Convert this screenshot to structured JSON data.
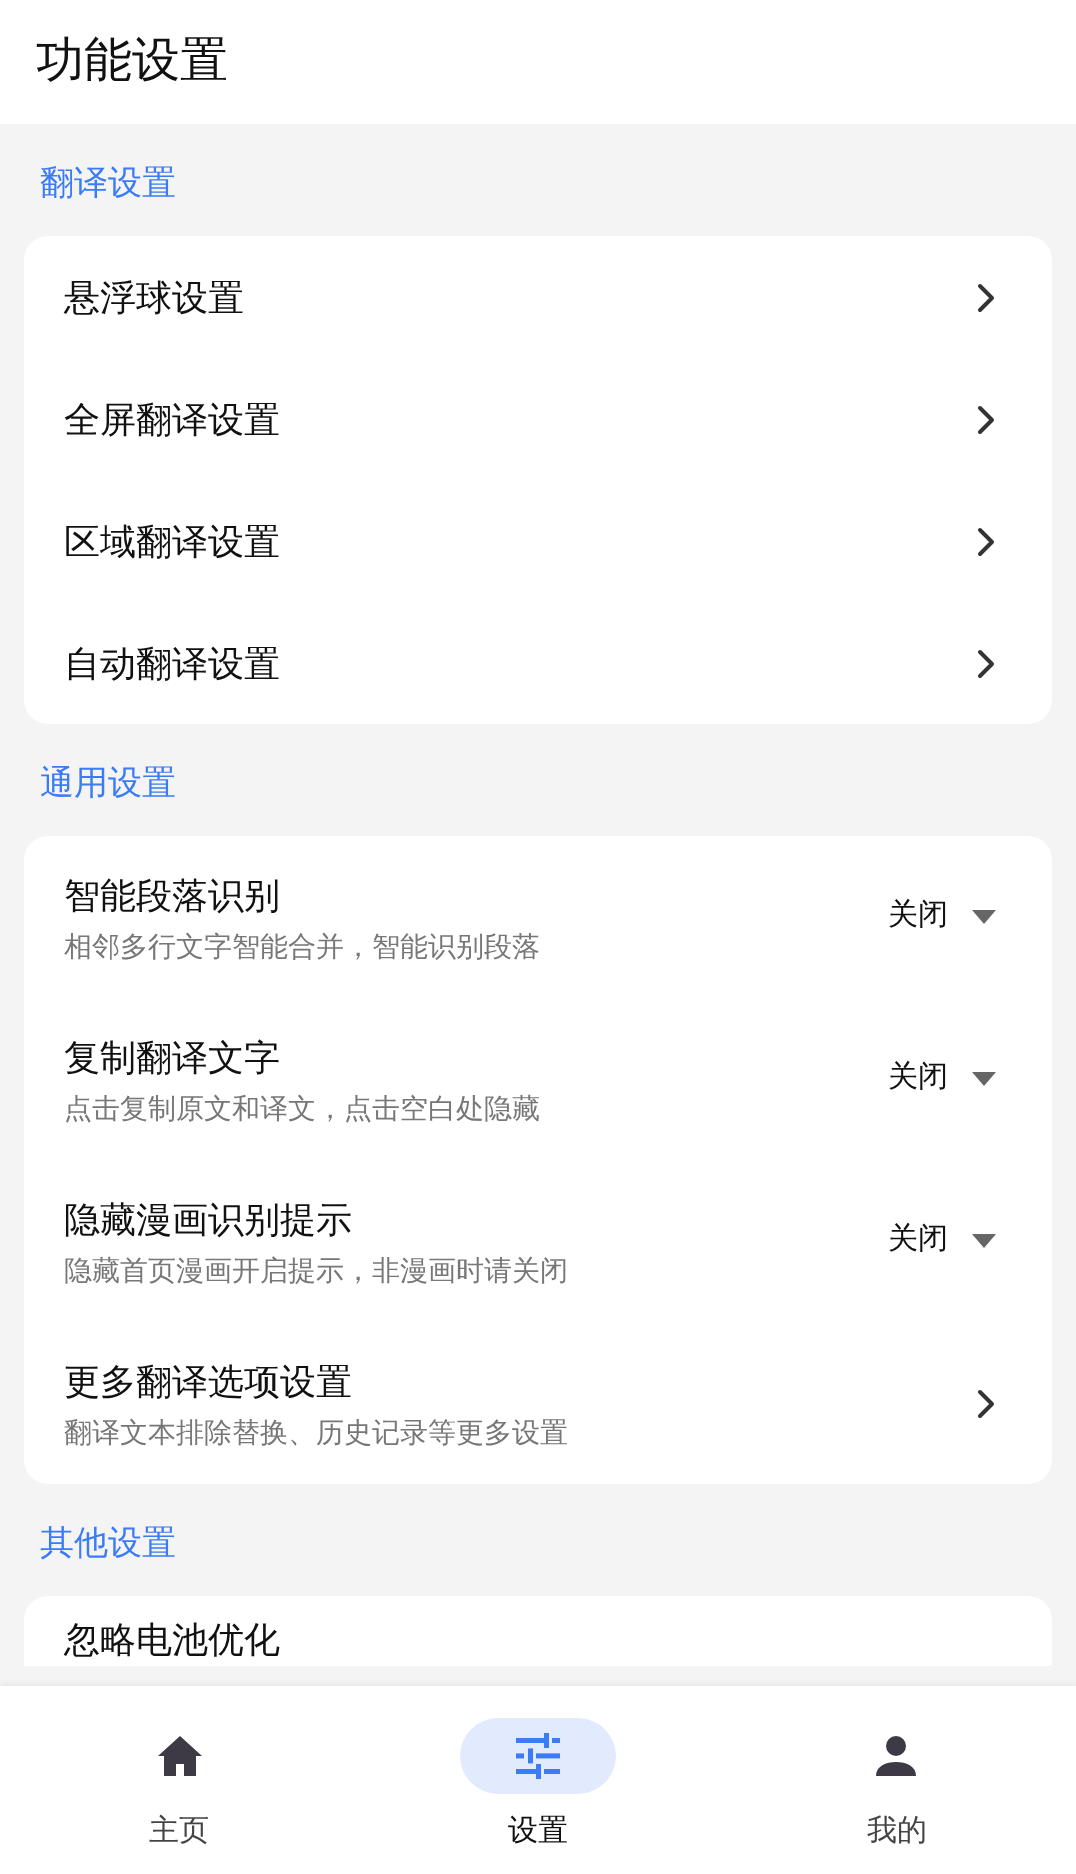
{
  "header": {
    "title": "功能设置"
  },
  "sections": [
    {
      "title": "翻译设置",
      "items": [
        {
          "kind": "link",
          "title": "悬浮球设置"
        },
        {
          "kind": "link",
          "title": "全屏翻译设置"
        },
        {
          "kind": "link",
          "title": "区域翻译设置"
        },
        {
          "kind": "link",
          "title": "自动翻译设置"
        }
      ]
    },
    {
      "title": "通用设置",
      "items": [
        {
          "kind": "dropdown",
          "title": "智能段落识别",
          "subtitle": "相邻多行文字智能合并，智能识别段落",
          "value": "关闭"
        },
        {
          "kind": "dropdown",
          "title": "复制翻译文字",
          "subtitle": "点击复制原文和译文，点击空白处隐藏",
          "value": "关闭"
        },
        {
          "kind": "dropdown",
          "title": "隐藏漫画识别提示",
          "subtitle": "隐藏首页漫画开启提示，非漫画时请关闭",
          "value": "关闭"
        },
        {
          "kind": "link",
          "title": "更多翻译选项设置",
          "subtitle": "翻译文本排除替换、历史记录等更多设置"
        }
      ]
    },
    {
      "title": "其他设置",
      "items": [
        {
          "kind": "partial",
          "title": "忽略电池优化"
        }
      ]
    }
  ],
  "nav": [
    {
      "kind": "home",
      "label": "主页",
      "selected": false
    },
    {
      "kind": "settings",
      "label": "设置",
      "selected": true
    },
    {
      "kind": "profile",
      "label": "我的",
      "selected": false
    }
  ]
}
